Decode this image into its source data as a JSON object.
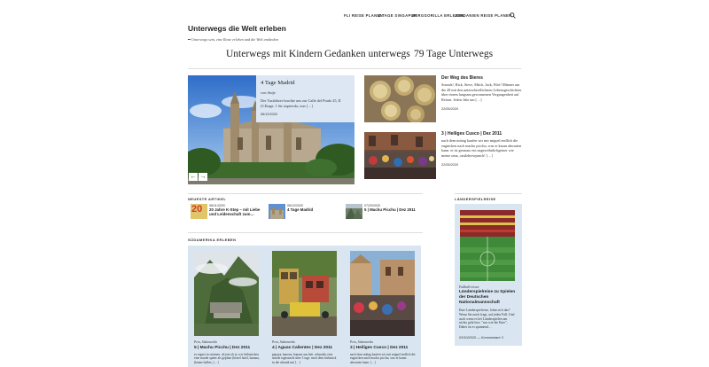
{
  "topnav": {
    "items": [
      "FLI REISE PLANEN",
      "4 TAGE SINGAPUR",
      "BERGGORILLA ERLEBEN",
      "JORDANIEN REISE PLANEN"
    ]
  },
  "site": {
    "title": "Unterwegs die Welt erleben",
    "tagline": "Unterwegs sein, eine Reise erleben und die Welt entdecken"
  },
  "mainnav": {
    "items": [
      "Unterwegs mit Kindern",
      "Gedanken unterwegs",
      "79 Tage Unterwegs"
    ]
  },
  "featured": {
    "title": "4 Tage Madrid",
    "author": "von Antje",
    "excerpt": "Der Taxifahrer brachte uns zur Calle del Prado 25, II (3.Etage, 1 für izquierda, was […]",
    "date": "06/12/2020",
    "prev": "←",
    "next": "→"
  },
  "sideposts": [
    {
      "title": "Der Weg des Bieres",
      "excerpt": "Sounds!, Rick, Steve, Mitch, Jack, Filet! Männer um die 28 mit den unterschiedlichsten Lebensgeschichten über einem langsam gewonnenen Vergangenheit auf Reisen. Jeden Jahr um […]",
      "date": "22/05/2020"
    },
    {
      "title": "3 | Heiliges Cusco | Dez 2011",
      "excerpt": "nach dem mittag kaufen wir mir miguel endlich die eugnicken nach machu picchu, was er kaum abwarten kann. er ist genauso ein ungewöhnlichgeiner wie meine oma, castlebrewpeach! […]",
      "date": "22/05/2020"
    }
  ],
  "newest": {
    "heading": "NEUESTE ARTIKEL",
    "items": [
      {
        "date": "06/11/2020",
        "title": "20 Jahre K-Step – mit Liebe und Leidenschaft zum…",
        "thumb": "20"
      },
      {
        "date": "06/12/2020",
        "title": "4 Tage Madrid"
      },
      {
        "date": "07/20/2020",
        "title": "5 | Machu Picchu | Dez 2011"
      }
    ]
  },
  "southamerica": {
    "heading": "SÜDAMERIKA ERLEBEN",
    "cards": [
      {
        "cat": "Peru, Südamerika",
        "title": "5 | Machu Picchu | Dez 2011",
        "excerpt": "es regnet in strömen. ob jetz ob je, wir frühstücken eine stunde später als geplant (hostel hotel, banana, (kenne halbes, […]"
      },
      {
        "cat": "Peru, Südamerika",
        "title": "4 | Aguas Calientes | Dez 2011",
        "excerpt": "papaya, kanone, banane aus bett. sebastiko eine stunde tagesnacht über 5 tage. nach dem frühstück in die altstadt mit […]"
      },
      {
        "cat": "Peru, Südamerika",
        "title": "3 | Heiliges Cusco | Dez 2011",
        "excerpt": "nach dem mittag kaufen wir mit miguel endlich die eugnicken nach machu picchu, was er kaum abwarten kann. […]"
      }
    ]
  },
  "sidebar": {
    "heading": "LÄNDERSPIELREISE",
    "cat": "Fußball-reisen",
    "title": "Länderspielreise zu Spielen der Deutschen Nationalmannschaft",
    "excerpt": "Eine Länderspielreise, lohnt sich das? Wenn Sie mich fragt, auf jeden Fall. Und auch wenn es bei Länderspielen um nichts geht bzw. \"nur wie die Ente\", Dabei ist es spannend…",
    "date": "03/10/2020",
    "comments": "Kommentare 3"
  },
  "colors": {
    "accent_box": "#d9e6f2",
    "caption_box": "#dce7f3"
  }
}
